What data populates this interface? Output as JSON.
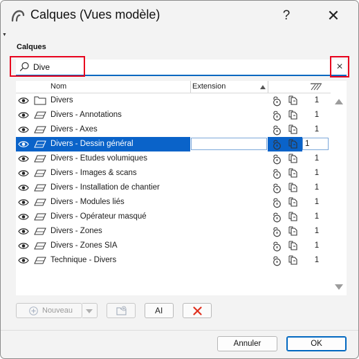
{
  "window": {
    "title": "Calques (Vues modèle)",
    "help_glyph": "?",
    "close_glyph": "✕"
  },
  "section_label": "Calques",
  "search": {
    "value": "Dive",
    "clear_glyph": "×",
    "icon": "search-icon"
  },
  "table": {
    "columns": {
      "name": "Nom",
      "extension": "Extension"
    },
    "rows": [
      {
        "name": "Divers",
        "type": "folder",
        "number": "1",
        "selected": false
      },
      {
        "name": "Divers - Annotations",
        "type": "layer",
        "number": "1",
        "selected": false
      },
      {
        "name": "Divers - Axes",
        "type": "layer",
        "number": "1",
        "selected": false
      },
      {
        "name": "Divers - Dessin général",
        "type": "layer",
        "number": "1",
        "selected": true
      },
      {
        "name": "Divers - Etudes volumiques",
        "type": "layer",
        "number": "1",
        "selected": false
      },
      {
        "name": "Divers - Images & scans",
        "type": "layer",
        "number": "1",
        "selected": false
      },
      {
        "name": "Divers - Installation de chantier",
        "type": "layer",
        "number": "1",
        "selected": false
      },
      {
        "name": "Divers - Modules liés",
        "type": "layer",
        "number": "1",
        "selected": false
      },
      {
        "name": "Divers - Opérateur masqué",
        "type": "layer",
        "number": "1",
        "selected": false
      },
      {
        "name": "Divers - Zones",
        "type": "layer",
        "number": "1",
        "selected": false
      },
      {
        "name": "Divers - Zones SIA",
        "type": "layer",
        "number": "1",
        "selected": false
      },
      {
        "name": "Technique - Divers",
        "type": "layer",
        "number": "1",
        "selected": false
      }
    ]
  },
  "toolbar": {
    "new_label": "Nouveau",
    "rename_glyph": "AI"
  },
  "footer": {
    "cancel_label": "Annuler",
    "ok_label": "OK"
  },
  "colors": {
    "selection": "#0a63c9",
    "highlight_outline": "#e8001c",
    "accent": "#0067c0",
    "delete": "#e0301e"
  }
}
